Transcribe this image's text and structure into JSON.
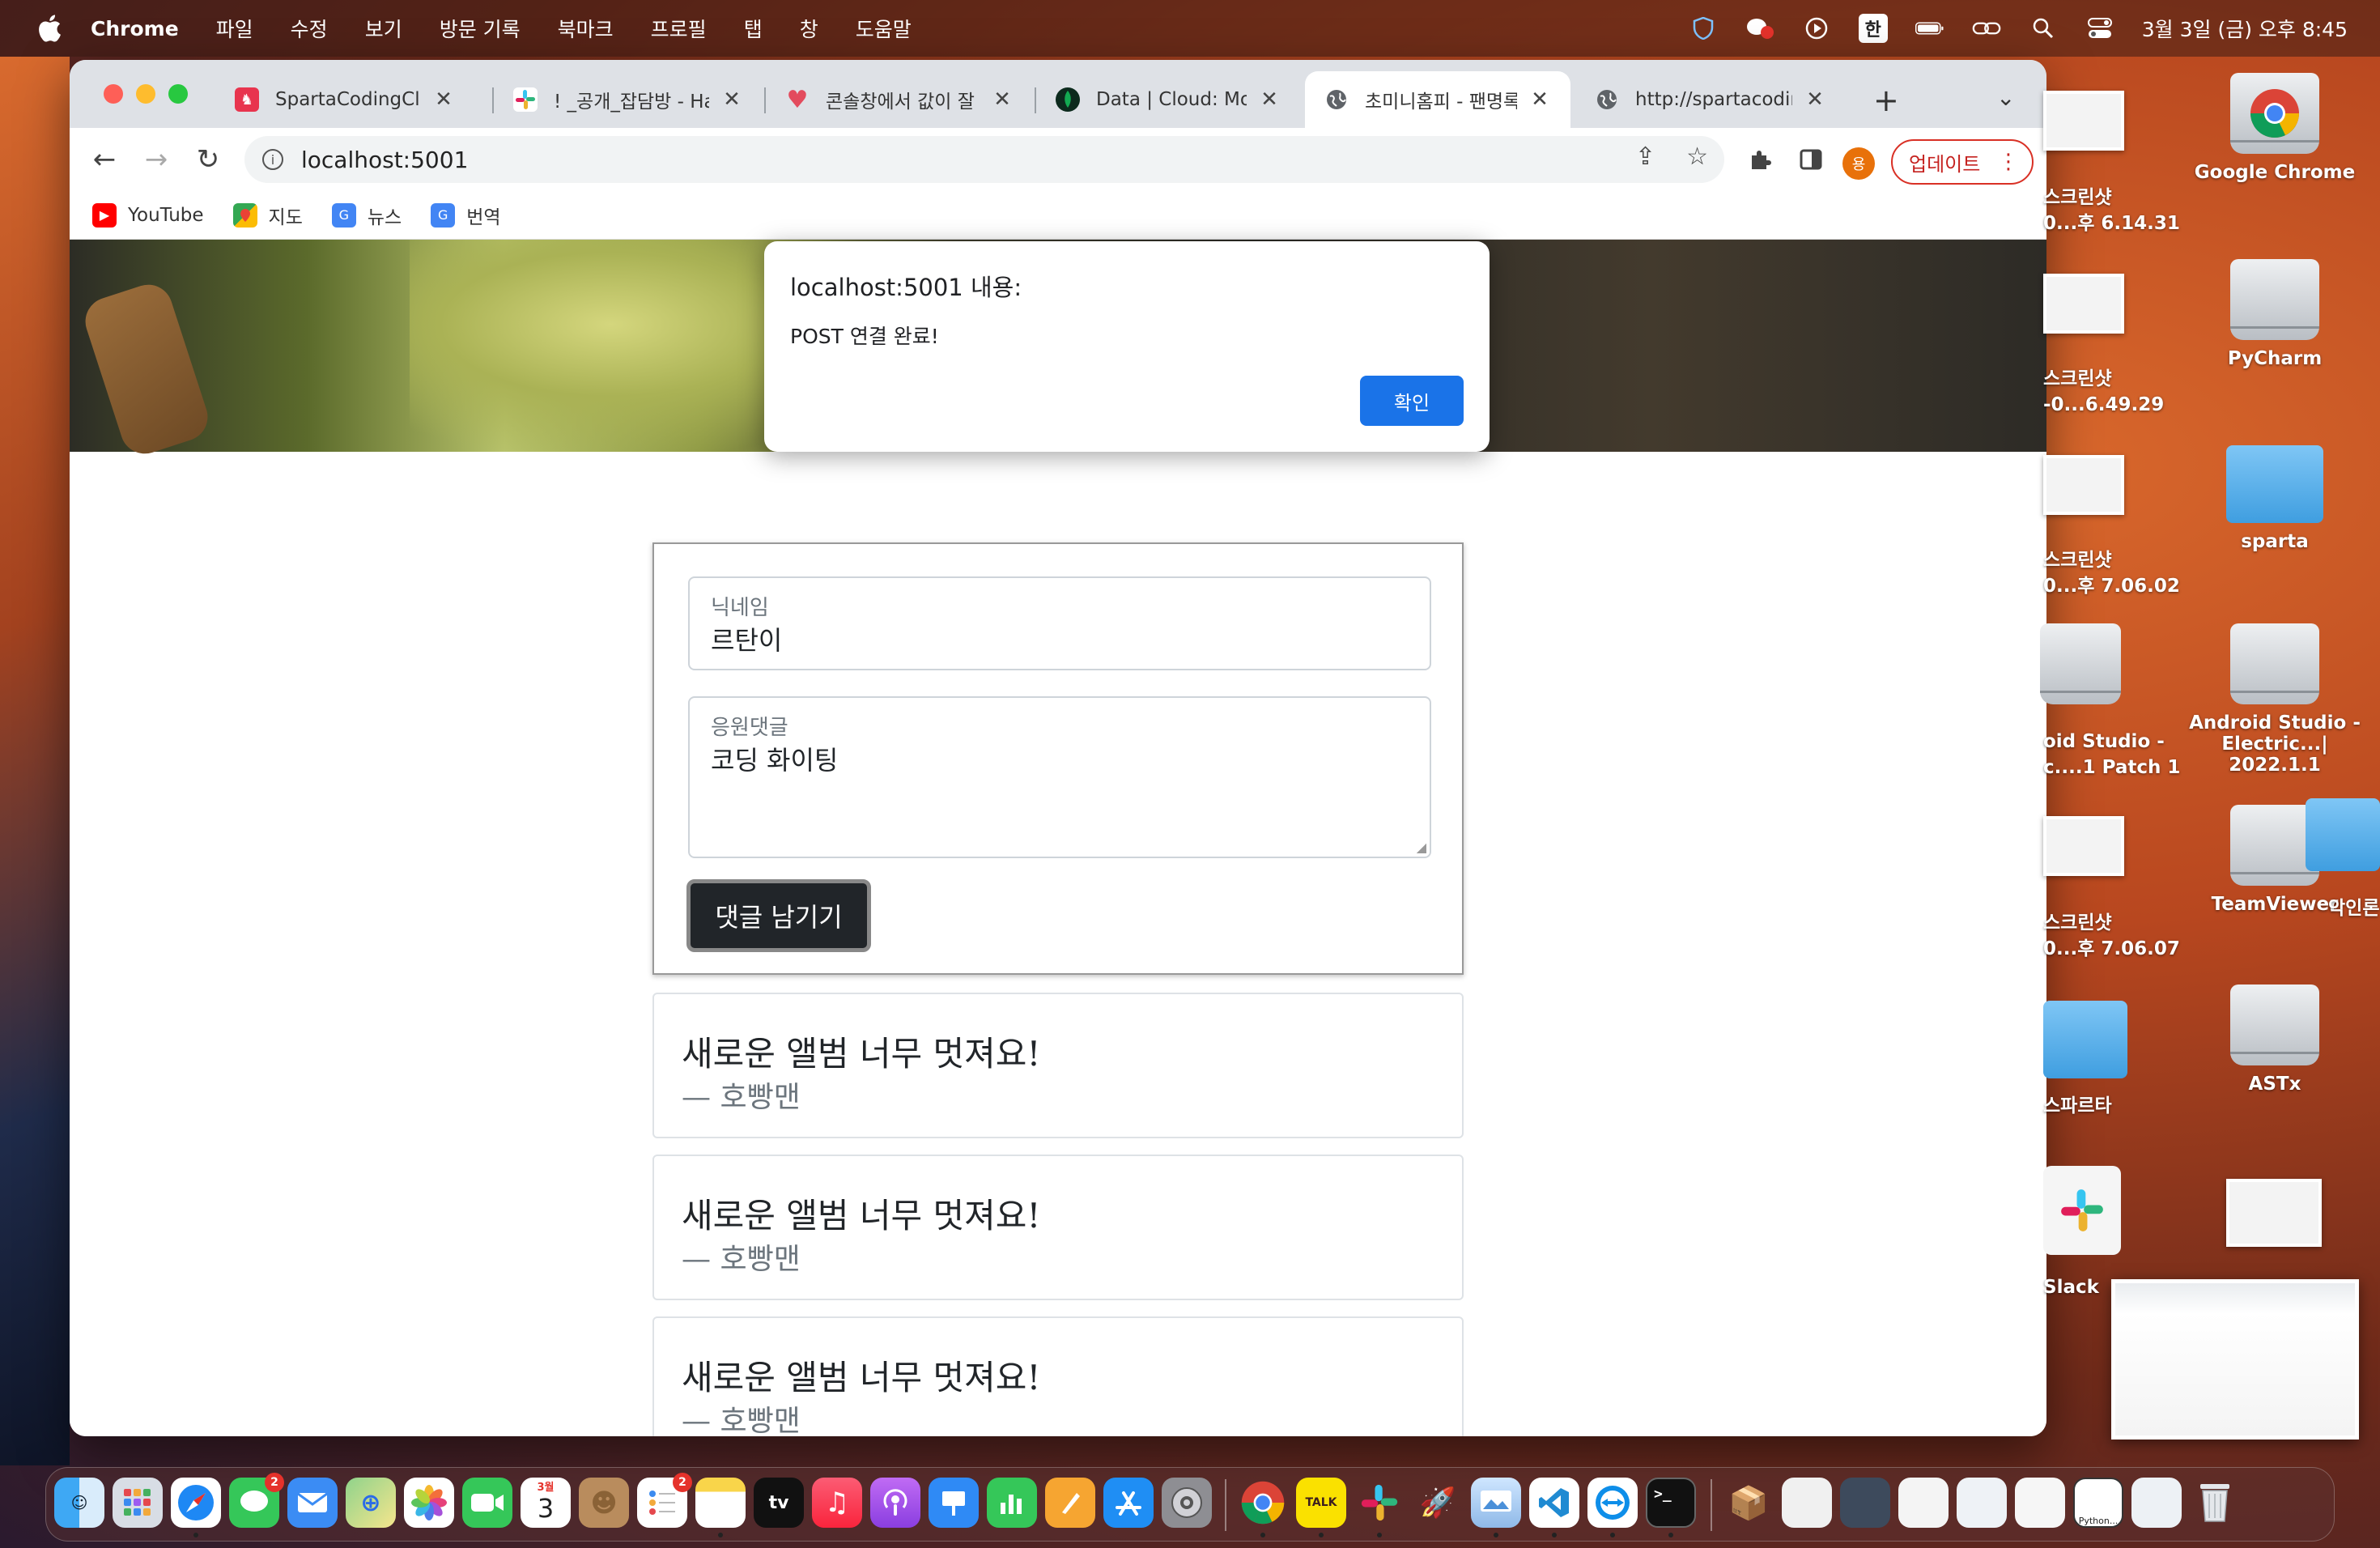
{
  "menubar": {
    "app_name": "Chrome",
    "items": [
      "파일",
      "수정",
      "보기",
      "방문 기록",
      "북마크",
      "프로필",
      "탭",
      "창",
      "도움말"
    ],
    "ime": "한",
    "clock": "3월 3일 (금) 오후 8:45"
  },
  "browser": {
    "tabs": [
      {
        "title": "SpartaCodingClub",
        "icon": "sparta-icon",
        "color": "#e8344e"
      },
      {
        "title": "! _공개_잡담방 - Har",
        "icon": "slack-icon",
        "color": "#4a154b"
      },
      {
        "title": "콘솔창에서 값이 잘 나",
        "icon": "heart-icon",
        "color": "#e34b5d"
      },
      {
        "title": "Data | Cloud: Mon",
        "icon": "mongodb-leaf-icon",
        "color": "#13aa52"
      },
      {
        "title": "초미니홈피 - 팬명록",
        "icon": "globe-icon",
        "color": "#5f6368"
      },
      {
        "title": "http://spartacodin",
        "icon": "globe-icon",
        "color": "#5f6368"
      }
    ],
    "url": "localhost:5001",
    "profile_initial": "용",
    "update_label": "업데이트",
    "bookmarks": [
      {
        "label": "YouTube",
        "icon": "youtube-icon",
        "color": "#ff0000"
      },
      {
        "label": "지도",
        "icon": "maps-icon",
        "color": "#34a853"
      },
      {
        "label": "뉴스",
        "icon": "news-icon",
        "color": "#4285f4"
      },
      {
        "label": "번역",
        "icon": "translate-icon",
        "color": "#4285f4"
      }
    ]
  },
  "page": {
    "form": {
      "nickname_label": "닉네임",
      "nickname_value": "르탄이",
      "comment_label": "응원댓글",
      "comment_value": "코딩 화이팅",
      "submit_label": "댓글 남기기"
    },
    "comments": [
      {
        "text": "새로운 앨범 너무 멋져요!",
        "author": "— 호빵맨"
      },
      {
        "text": "새로운 앨범 너무 멋져요!",
        "author": "— 호빵맨"
      },
      {
        "text": "새로운 앨범 너무 멋져요!",
        "author": "— 호빵맨"
      }
    ]
  },
  "alert": {
    "title": "localhost:5001 내용:",
    "message": "POST 연결 완료!",
    "ok_label": "확인"
  },
  "desktop": {
    "icons": [
      "Google Chrome",
      "PyCharm",
      "sparta",
      "Android Studio - Electric...| 2022.1.1",
      "TeamViewer",
      "ASTx"
    ],
    "partial_labels": [
      [
        "스크린샷",
        "0...후 6.14.31"
      ],
      [
        "스크린샷",
        "-0...6.49.29"
      ],
      [
        "스크린샷",
        "0...후 7.06.02"
      ],
      [
        "oid Studio -",
        "c....1 Patch 1"
      ],
      [
        "스크린샷",
        "0...후 7.06.07"
      ],
      [
        "스파르타"
      ],
      [
        "Slack"
      ]
    ],
    "extra_label": "악인론"
  },
  "dock": {
    "messages_badge": "2",
    "reminders_badge": "2",
    "calendar_month": "3월",
    "calendar_day": "3",
    "talk_label": "TALK",
    "python_label": "Python..."
  }
}
